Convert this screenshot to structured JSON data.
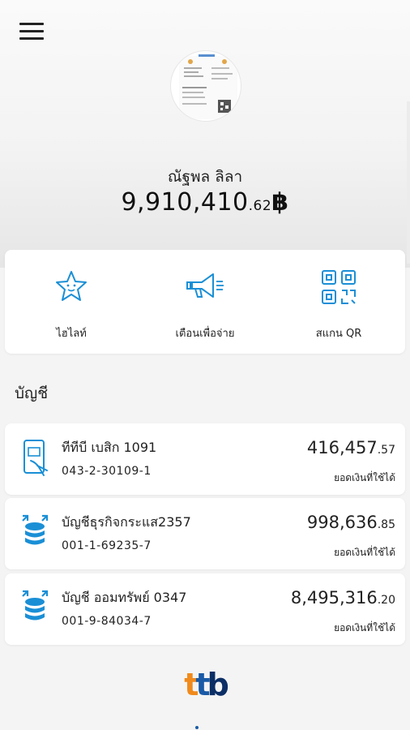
{
  "profile": {
    "name": "ณัฐพล ลิลา"
  },
  "total_balance": {
    "main": "9,910,410",
    "decimal": ".62",
    "currency": "฿"
  },
  "quick_actions": [
    {
      "label": "ไฮไลท์",
      "icon": "star-icon"
    },
    {
      "label": "เตือนเพื่อจ่าย",
      "icon": "megaphone-icon"
    },
    {
      "label": "สแกน QR",
      "icon": "qr-code-icon"
    }
  ],
  "accounts_section": {
    "title": "บัญชี"
  },
  "accounts": [
    {
      "name": "ทีทีบี เบสิก 1091",
      "number": "043-2-30109-1",
      "balance_main": "416,457",
      "balance_decimal": ".57",
      "available_label": "ยอดเงินที่ใช้ได้",
      "icon": "phone-card-icon"
    },
    {
      "name": "บัญชีธุรกิจกระแส2357",
      "number": "001-1-69235-7",
      "balance_main": "998,636",
      "balance_decimal": ".85",
      "available_label": "ยอดเงินที่ใช้ได้",
      "icon": "coin-stack-icon"
    },
    {
      "name": "บัญชี ออมทรัพย์ 0347",
      "number": "001-9-84034-7",
      "balance_main": "8,495,316",
      "balance_decimal": ".20",
      "available_label": "ยอดเงินที่ใช้ได้",
      "icon": "coin-stack-icon"
    }
  ],
  "brand": {
    "logo_text": "ttb"
  },
  "colors": {
    "accent_blue": "#1a8fd6",
    "brand_orange": "#f08a1c",
    "brand_navy": "#0b2e66"
  }
}
